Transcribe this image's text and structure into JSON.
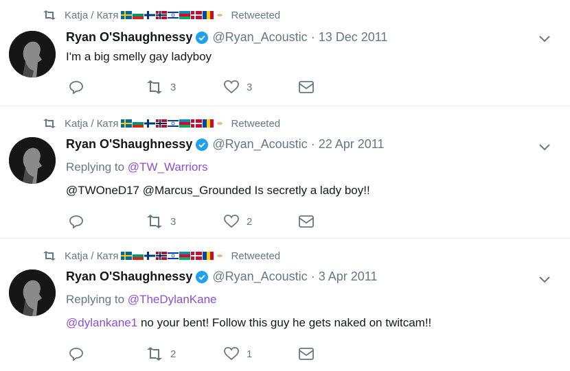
{
  "tweets": [
    {
      "retweeted_by": "Katja / Катя",
      "retweeted_label": "Retweeted",
      "name": "Ryan O'Shaughnessy",
      "handle": "@Ryan_Acoustic",
      "separator": "·",
      "date": "13 Dec 2011",
      "replying_to": "",
      "text_mention": "",
      "text": "I'm a big smelly gay ladyboy",
      "replies": "",
      "retweets": "3",
      "likes": "3"
    },
    {
      "retweeted_by": "Katja / Катя",
      "retweeted_label": "Retweeted",
      "name": "Ryan O'Shaughnessy",
      "handle": "@Ryan_Acoustic",
      "separator": "·",
      "date": "22 Apr 2011",
      "replying_prefix": "Replying to",
      "replying_to": "@TW_Warriors",
      "text_mention": "",
      "text": "@TWOneD17 @Marcus_Grounded Is secretly a lady boy!!",
      "replies": "",
      "retweets": "3",
      "likes": "2"
    },
    {
      "retweeted_by": "Katja / Катя",
      "retweeted_label": "Retweeted",
      "name": "Ryan O'Shaughnessy",
      "handle": "@Ryan_Acoustic",
      "separator": "·",
      "date": "3 Apr 2011",
      "replying_prefix": "Replying to",
      "replying_to": "@TheDylanKane",
      "text_mention": "@dylankane1",
      "text": " no your bent! Follow this guy he gets naked on twitcam!!",
      "replies": "",
      "retweets": "2",
      "likes": "1"
    }
  ],
  "icons": {
    "retweet": "retweet-icon",
    "verified": "verified-badge-icon",
    "chevron": "chevron-down-icon",
    "reply": "reply-icon",
    "like": "heart-icon",
    "dm": "envelope-icon"
  },
  "colors": {
    "text": "#14171a",
    "muted": "#657786",
    "link": "#8b4fd6",
    "verified": "#1da1f2",
    "divider": "#e6ecf0"
  }
}
